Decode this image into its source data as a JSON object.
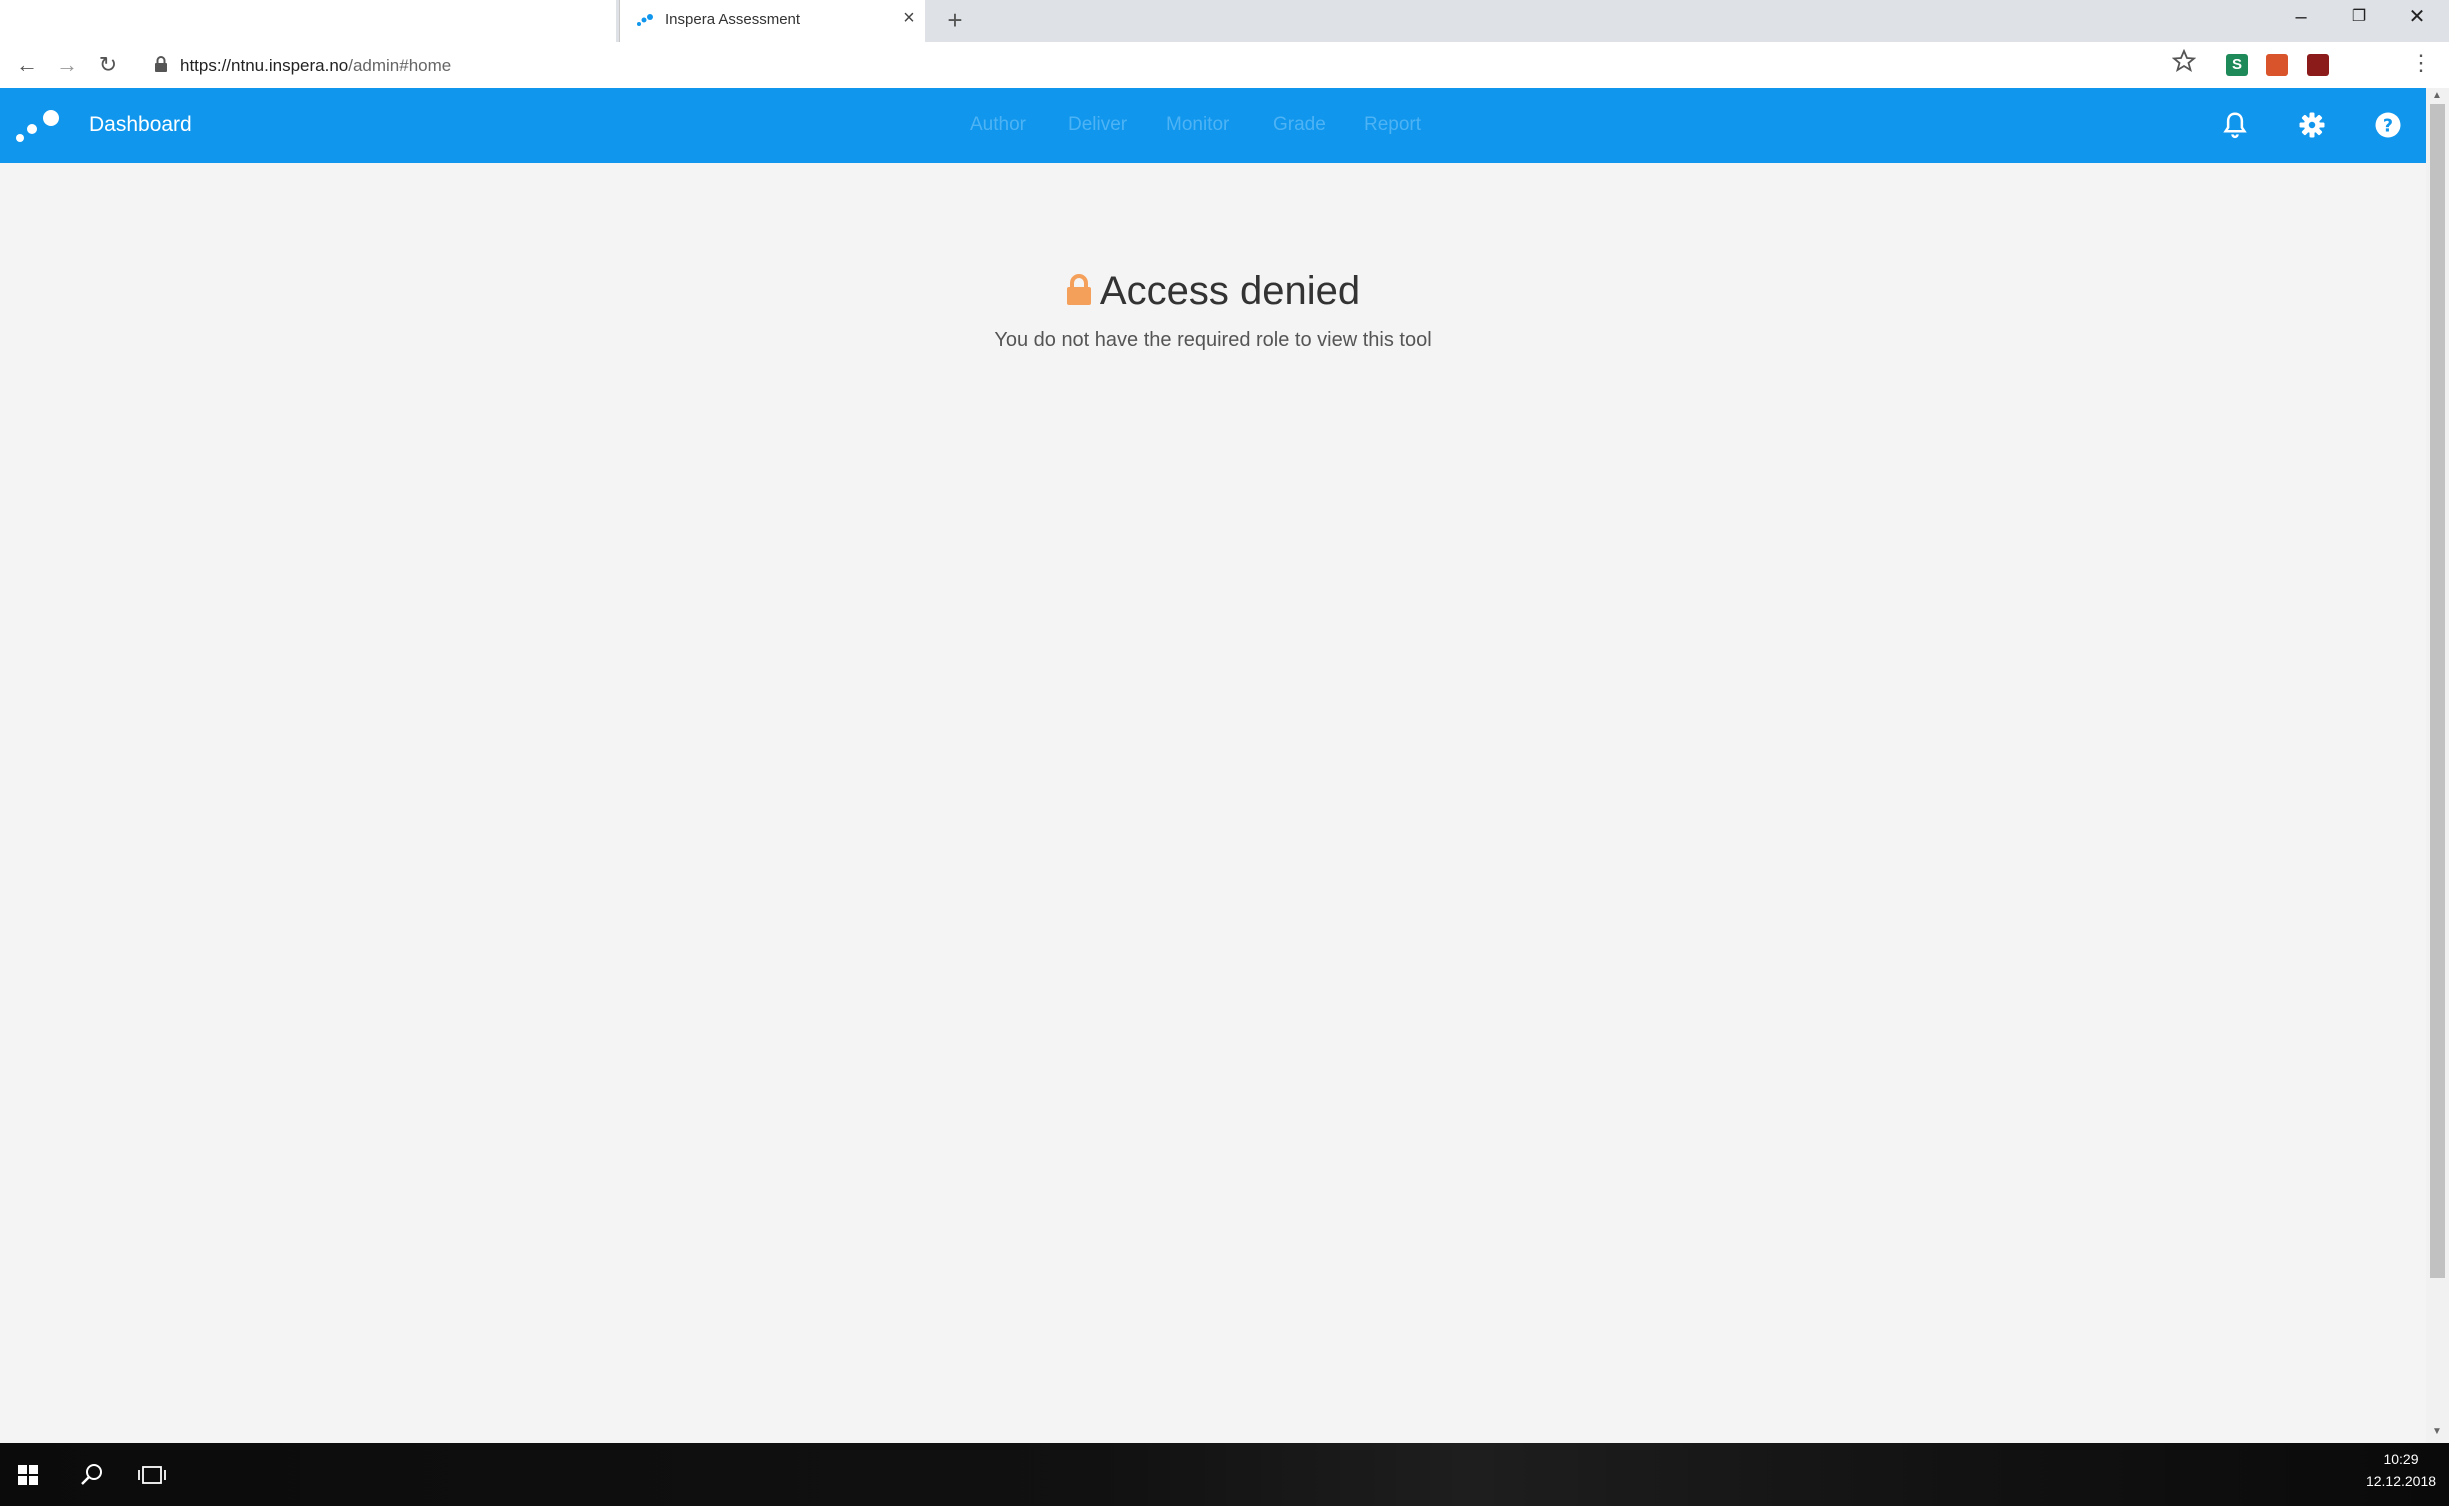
{
  "browser": {
    "tab_title": "Inspera Assessment",
    "tab_close": "×",
    "new_tab": "+",
    "window_controls": {
      "minimize": "–",
      "restore": "❐",
      "close": "✕"
    },
    "nav": {
      "back": "←",
      "forward": "→",
      "reload": "↻"
    },
    "address": {
      "host": "https://ntnu.inspera.no",
      "path": "/admin#home"
    },
    "bookmark_icon": "star-icon",
    "extensions": [
      {
        "label": "S",
        "color": "#1e8a5a"
      },
      {
        "label": "",
        "color": "#d9532b"
      },
      {
        "label": "",
        "color": "#8b1a1a"
      }
    ],
    "menu": "⋮"
  },
  "app": {
    "header": {
      "title": "Dashboard",
      "nav": [
        "Author",
        "Deliver",
        "Monitor",
        "Grade",
        "Report"
      ],
      "icons": [
        "bell-icon",
        "gear-icon",
        "help-icon"
      ],
      "accent": "#1096ec"
    },
    "message": {
      "title": "Access denied",
      "subtitle": "You do not have the required role to view this tool",
      "icon": "lock-icon",
      "icon_color": "#f5a05a"
    }
  },
  "taskbar": {
    "time": "10:29",
    "date": "12.12.2018"
  }
}
